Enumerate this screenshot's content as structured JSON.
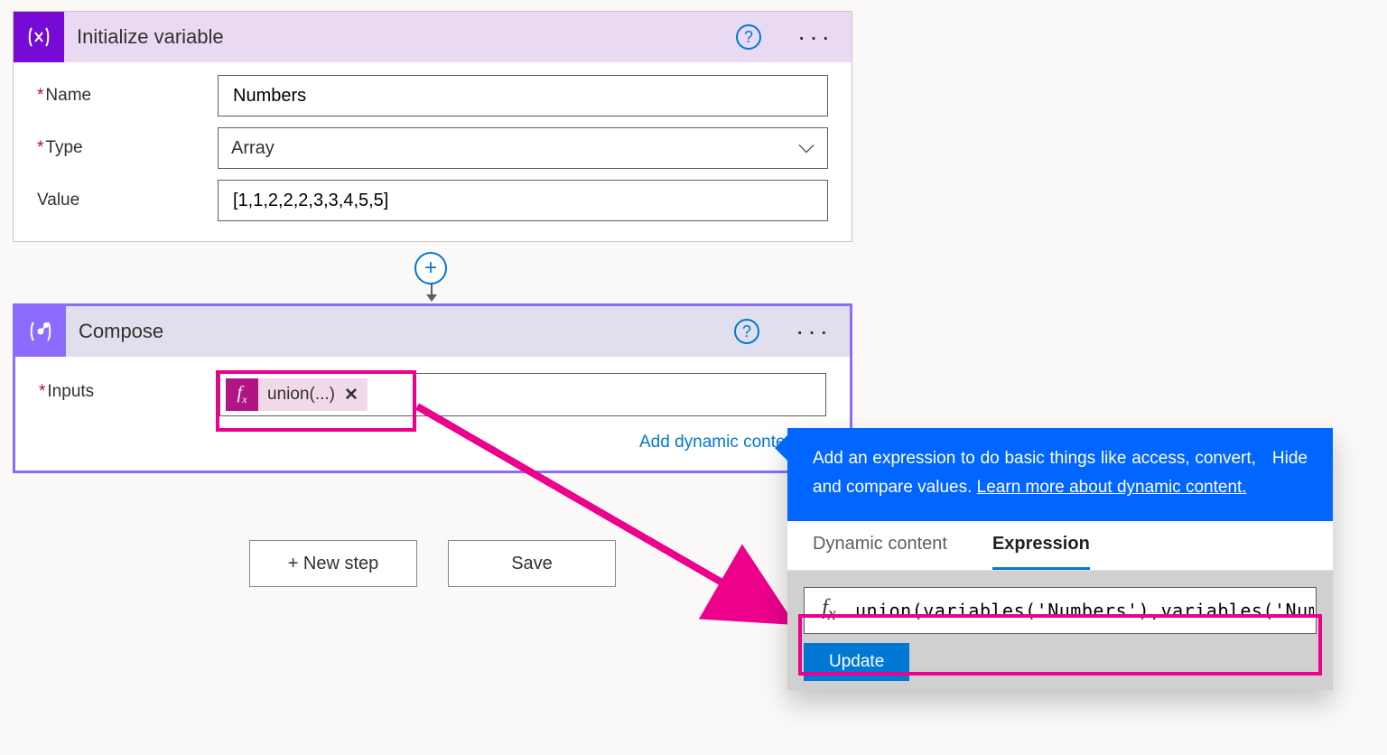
{
  "card_init": {
    "title": "Initialize variable",
    "fields": {
      "name_label": "Name",
      "name_value": "Numbers",
      "type_label": "Type",
      "type_value": "Array",
      "value_label": "Value",
      "value_value": "[1,1,2,2,2,3,3,4,5,5]"
    }
  },
  "card_compose": {
    "title": "Compose",
    "inputs_label": "Inputs",
    "token_text": "union(...)",
    "dynamic_link": "Add dynamic content"
  },
  "buttons": {
    "new_step": "+ New step",
    "save": "Save"
  },
  "flyout": {
    "hint_a": "Add an expression to do basic things like access, convert, and compare values. ",
    "hint_link": "Learn more about dynamic content.",
    "hide": "Hide",
    "tab_dc": "Dynamic content",
    "tab_expr": "Expression",
    "expr_value": "union(variables('Numbers'),variables('Numbers'))",
    "update": "Update"
  }
}
